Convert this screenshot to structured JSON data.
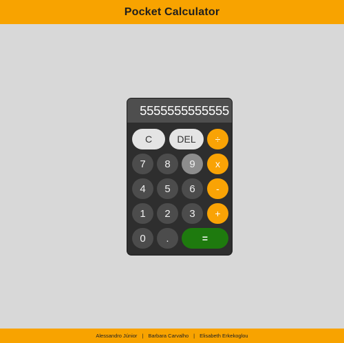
{
  "header": {
    "title": "Pocket Calculator"
  },
  "display": {
    "value": "5555555555555"
  },
  "keys": {
    "clear": "C",
    "delete": "DEL",
    "divide": "÷",
    "seven": "7",
    "eight": "8",
    "nine": "9",
    "multiply": "x",
    "four": "4",
    "five": "5",
    "six": "6",
    "subtract": "-",
    "one": "1",
    "two": "2",
    "three": "3",
    "add": "+",
    "zero": "0",
    "decimal": ".",
    "equals": "="
  },
  "footer": {
    "authors": [
      "Alessandro Júnior",
      "Barbara Carvalho",
      "Elisabeth Erkekoglou"
    ],
    "separator": "|"
  },
  "colors": {
    "accent": "#f8a300",
    "background": "#d8d8d8",
    "calculator_body": "#2e2e2e",
    "display": "#4e4e4e",
    "number_key": "#4c4c4c",
    "pressed_key": "#8d8d8d",
    "function_key": "#e4e4e4",
    "equals_key": "#1e7a0e"
  }
}
